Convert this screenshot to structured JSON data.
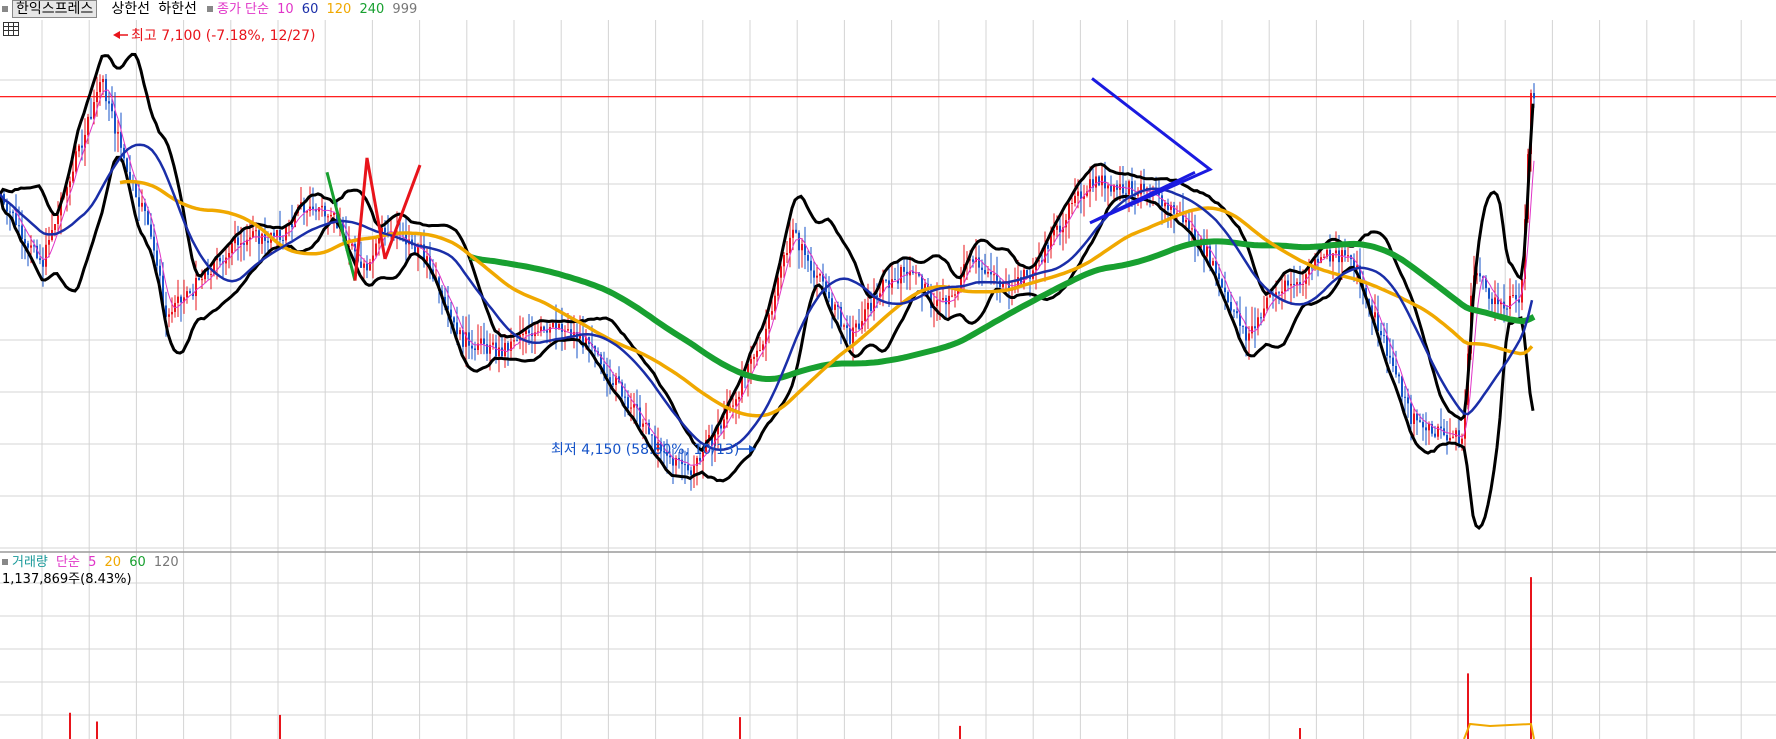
{
  "price_legend": {
    "stock_button": "한익스프레스",
    "upper_limit": "상한선",
    "lower_limit": "하한선",
    "ma_label": "종가 단순",
    "periods": [
      "10",
      "60",
      "120",
      "240",
      "999"
    ]
  },
  "volume_legend": {
    "title": "거래량",
    "ma_label": "단순",
    "periods": [
      "5",
      "20",
      "60",
      "120"
    ],
    "current_volume": "1,137,869주(8.43%)"
  },
  "colors": {
    "up": "#e8141b",
    "down": "#1553c8",
    "ma10": "#e035c8",
    "ma60": "#1a2ea8",
    "ma120": "#f0a800",
    "ma240": "#18a030",
    "bollinger": "#000000",
    "grid": "#d4d4d4",
    "hline": "#ff0000"
  },
  "annotations": {
    "high": "최고 7,100 (-7.18%, 12/27)",
    "low": "최저 4,150 (58.80%, 10/13)"
  },
  "chart_data": {
    "type": "candlestick",
    "price_range": [
      3700,
      7250
    ],
    "period_high": 7100,
    "period_low": 4150,
    "grid": true,
    "legend": "top-left",
    "price_control_points": [
      [
        0,
        6150
      ],
      [
        40,
        5650
      ],
      [
        80,
        6500
      ],
      [
        100,
        6950
      ],
      [
        125,
        6350
      ],
      [
        150,
        5900
      ],
      [
        165,
        5300
      ],
      [
        200,
        5550
      ],
      [
        240,
        5850
      ],
      [
        280,
        5850
      ],
      [
        300,
        6050
      ],
      [
        330,
        6050
      ],
      [
        345,
        5800
      ],
      [
        365,
        5650
      ],
      [
        380,
        5900
      ],
      [
        400,
        5850
      ],
      [
        420,
        5750
      ],
      [
        440,
        5500
      ],
      [
        460,
        5150
      ],
      [
        500,
        5050
      ],
      [
        540,
        5250
      ],
      [
        580,
        5150
      ],
      [
        620,
        4800
      ],
      [
        660,
        4350
      ],
      [
        690,
        4250
      ],
      [
        720,
        4550
      ],
      [
        760,
        5100
      ],
      [
        790,
        5900
      ],
      [
        815,
        5600
      ],
      [
        850,
        5150
      ],
      [
        880,
        5500
      ],
      [
        910,
        5650
      ],
      [
        930,
        5400
      ],
      [
        950,
        5400
      ],
      [
        970,
        5750
      ],
      [
        1000,
        5500
      ],
      [
        1030,
        5600
      ],
      [
        1060,
        5950
      ],
      [
        1090,
        6250
      ],
      [
        1120,
        6200
      ],
      [
        1150,
        6150
      ],
      [
        1180,
        6000
      ],
      [
        1210,
        5700
      ],
      [
        1245,
        5150
      ],
      [
        1270,
        5450
      ],
      [
        1300,
        5550
      ],
      [
        1320,
        5750
      ],
      [
        1350,
        5700
      ],
      [
        1380,
        5200
      ],
      [
        1410,
        4600
      ],
      [
        1440,
        4500
      ],
      [
        1462,
        4450
      ],
      [
        1472,
        5650
      ],
      [
        1485,
        5500
      ],
      [
        1500,
        5350
      ],
      [
        1520,
        5450
      ],
      [
        1530,
        6800
      ],
      [
        1534,
        6850
      ]
    ],
    "trendline_points": [
      [
        1092,
        6950
      ],
      [
        1210,
        6320
      ],
      [
        1090,
        5950
      ],
      [
        1195,
        6300
      ]
    ],
    "zigzag_points": [
      [
        327,
        6300
      ],
      [
        355,
        5550
      ],
      [
        367,
        6400
      ],
      [
        385,
        5700
      ],
      [
        420,
        6350
      ]
    ],
    "volume": {
      "ylim": [
        0,
        400
      ],
      "spikes": [
        [
          70,
          60
        ],
        [
          97,
          40
        ],
        [
          280,
          55
        ],
        [
          740,
          50
        ],
        [
          960,
          30
        ],
        [
          1300,
          25
        ],
        [
          1468,
          150
        ],
        [
          1531,
          370
        ]
      ]
    }
  }
}
